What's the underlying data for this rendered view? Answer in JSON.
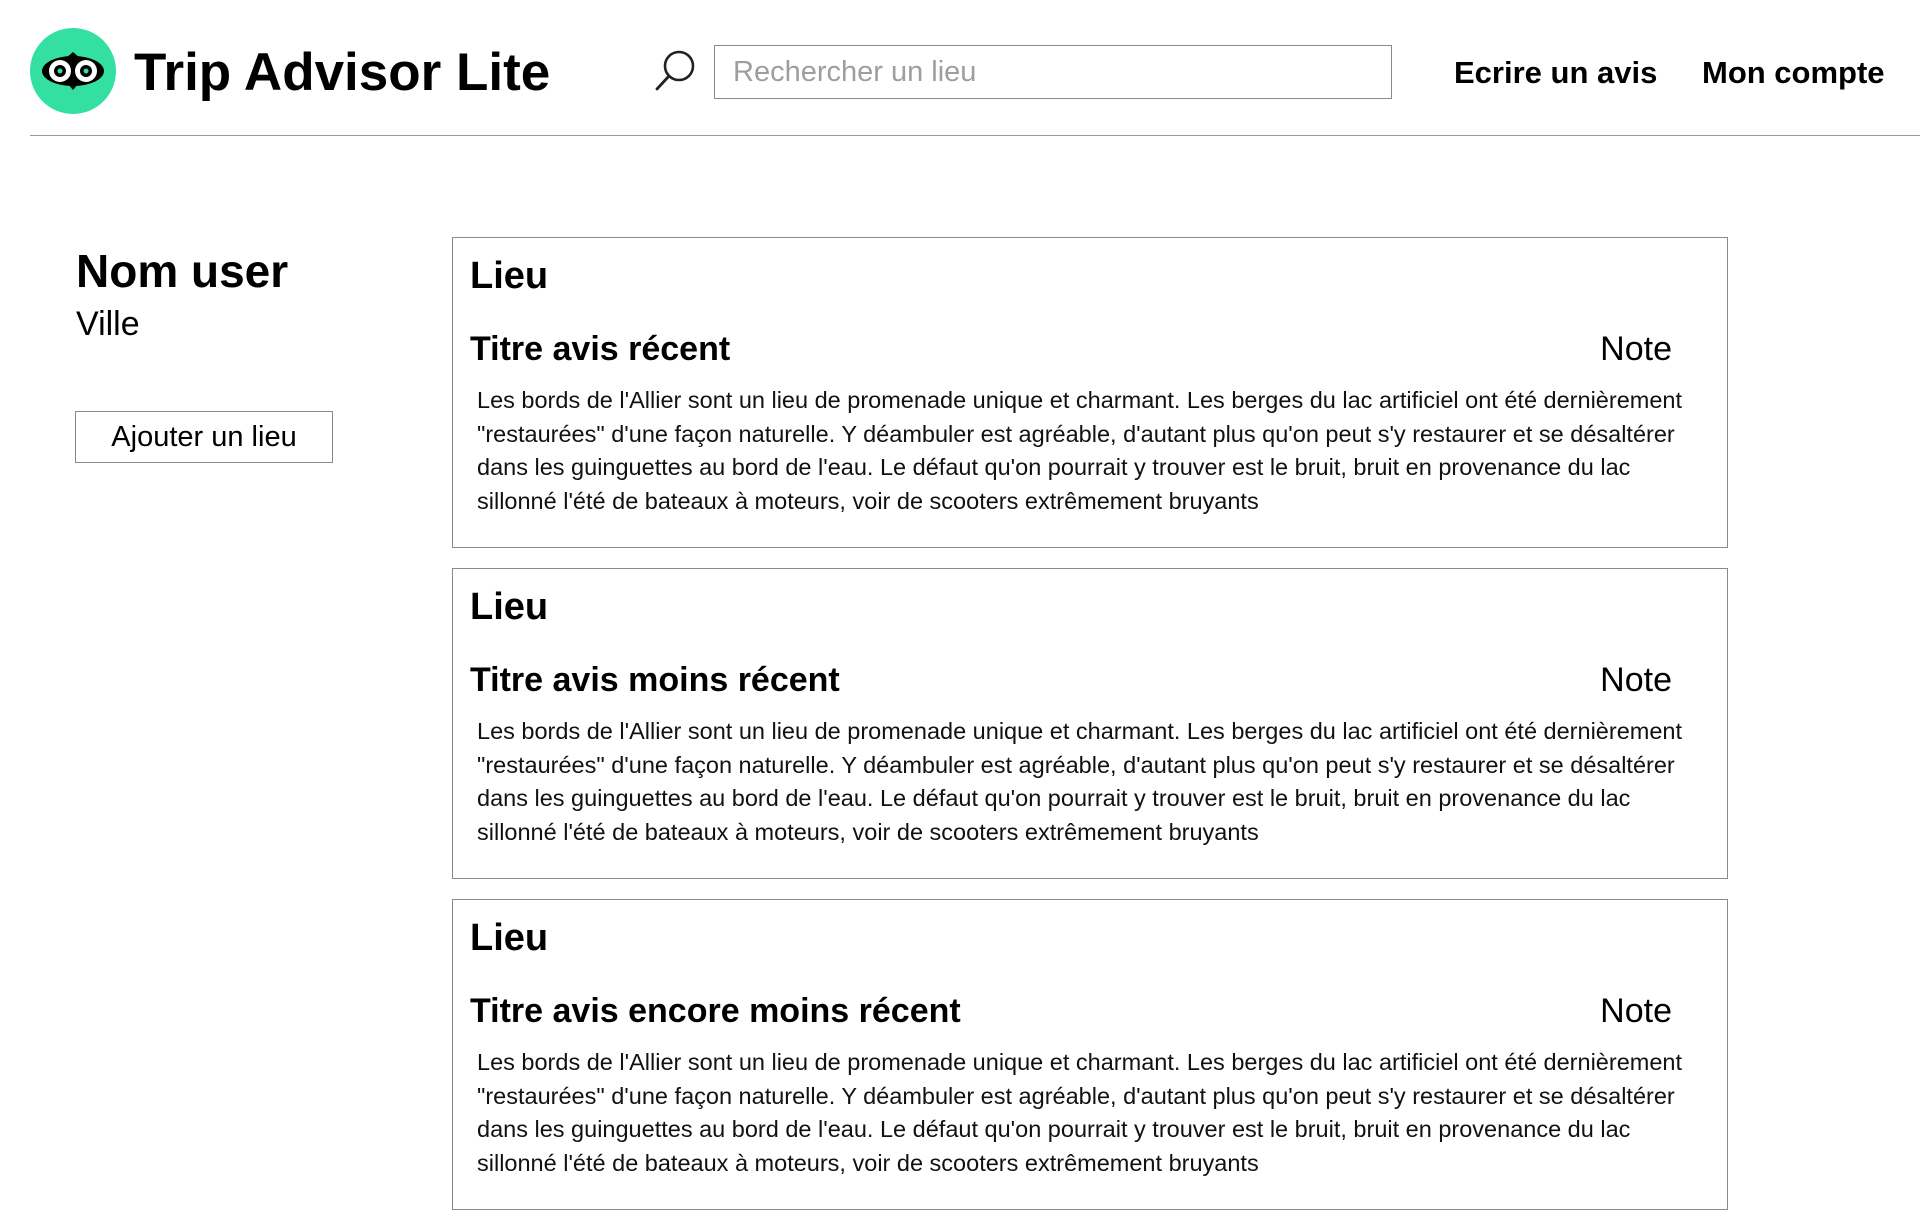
{
  "header": {
    "app_title": "Trip Advisor Lite",
    "logo_icon": "owl-icon",
    "logo_color": "#34e0a1",
    "search_icon": "search-icon",
    "search_placeholder": "Rechercher un lieu",
    "search_value": "",
    "nav": {
      "write_review": "Ecrire un avis",
      "my_account": "Mon compte"
    }
  },
  "profile": {
    "name": "Nom user",
    "city": "Ville",
    "add_place_button": "Ajouter un lieu"
  },
  "reviews": [
    {
      "place": "Lieu",
      "title": "Titre avis récent",
      "note": "Note",
      "body": "Les bords de l'Allier sont un lieu de promenade unique et charmant. Les berges du lac artificiel ont été dernièrement \"restaurées\" d'une façon naturelle. Y déambuler est agréable, d'autant plus qu'on peut s'y restaurer et se désaltérer dans les guinguettes au bord de l'eau. Le défaut qu'on pourrait y trouver est le bruit, bruit en provenance du lac sillonné l'été de bateaux à moteurs, voir de scooters extrêmement bruyants"
    },
    {
      "place": "Lieu",
      "title": "Titre avis moins récent",
      "note": "Note",
      "body": "Les bords de l'Allier sont un lieu de promenade unique et charmant. Les berges du lac artificiel ont été dernièrement \"restaurées\" d'une façon naturelle. Y déambuler est agréable, d'autant plus qu'on peut s'y restaurer et se désaltérer dans les guinguettes au bord de l'eau. Le défaut qu'on pourrait y trouver est le bruit, bruit en provenance du lac sillonné l'été de bateaux à moteurs, voir de scooters extrêmement bruyants"
    },
    {
      "place": "Lieu",
      "title": "Titre avis encore moins récent",
      "note": "Note",
      "body": "Les bords de l'Allier sont un lieu de promenade unique et charmant. Les berges du lac artificiel ont été dernièrement \"restaurées\" d'une façon naturelle. Y déambuler est agréable, d'autant plus qu'on peut s'y restaurer et se désaltérer dans les guinguettes au bord de l'eau. Le défaut qu'on pourrait y trouver est le bruit, bruit en provenance du lac sillonné l'été de bateaux à moteurs, voir de scooters extrêmement bruyants"
    }
  ]
}
